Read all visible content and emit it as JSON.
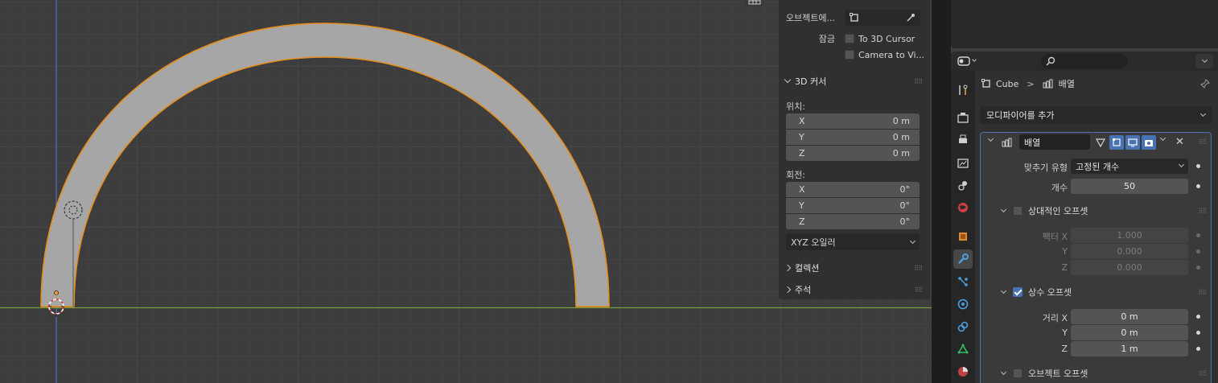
{
  "colors": {
    "accent": "#4772b3",
    "selection_outline": "#e88e1a",
    "mesh_fill": "#a6a6a6",
    "x_axis": "#7f9c3b",
    "y_axis": "#4a72c6",
    "cursor_red": "#e03030"
  },
  "viewport": {
    "view_toggle_icon": "grid-view-icon"
  },
  "npanel": {
    "object_label": "오브젝트에...",
    "lock_label": "잠금",
    "to_3d_cursor": "To 3D Cursor",
    "camera_to_view": "Camera to Vi...",
    "cursor_header": "3D 커서",
    "location_label": "위치:",
    "location": [
      {
        "axis": "X",
        "value": "0 m"
      },
      {
        "axis": "Y",
        "value": "0 m"
      },
      {
        "axis": "Z",
        "value": "0 m"
      }
    ],
    "rotation_label": "회전:",
    "rotation": [
      {
        "axis": "X",
        "value": "0°"
      },
      {
        "axis": "Y",
        "value": "0°"
      },
      {
        "axis": "Z",
        "value": "0°"
      }
    ],
    "rotation_mode": "XYZ 오일러",
    "collection_header": "컬렉션",
    "annotation_header": "주석"
  },
  "properties": {
    "search_placeholder": "",
    "breadcrumb_object": "Cube",
    "breadcrumb_modifier": "배열",
    "add_modifier": "모디파이어를 추가",
    "modifier": {
      "name": "배열",
      "fit_type_label": "맞추기 유형",
      "fit_type_value": "고정된 개수",
      "count_label": "개수",
      "count_value": "50",
      "relative_offset_label": "상대적인 오프셋",
      "relative_offset_enabled": false,
      "factor_x_label": "팩터 X",
      "factor_x": "1.000",
      "factor_y_label": "Y",
      "factor_y": "0.000",
      "factor_z_label": "Z",
      "factor_z": "0.000",
      "constant_offset_label": "상수 오프셋",
      "constant_offset_enabled": true,
      "distance_x_label": "거리 X",
      "distance_x": "0 m",
      "distance_y_label": "Y",
      "distance_y": "0 m",
      "distance_z_label": "Z",
      "distance_z": "1 m",
      "object_offset_label": "오브젝트 오프셋",
      "object_offset_enabled": false
    },
    "tabs": [
      "tool-icon",
      "render-icon",
      "output-icon",
      "view-layer-icon",
      "scene-icon",
      "world-icon",
      "object-icon",
      "modifier-icon",
      "particles-icon",
      "physics-icon",
      "constraints-icon",
      "data-icon",
      "material-icon"
    ]
  }
}
